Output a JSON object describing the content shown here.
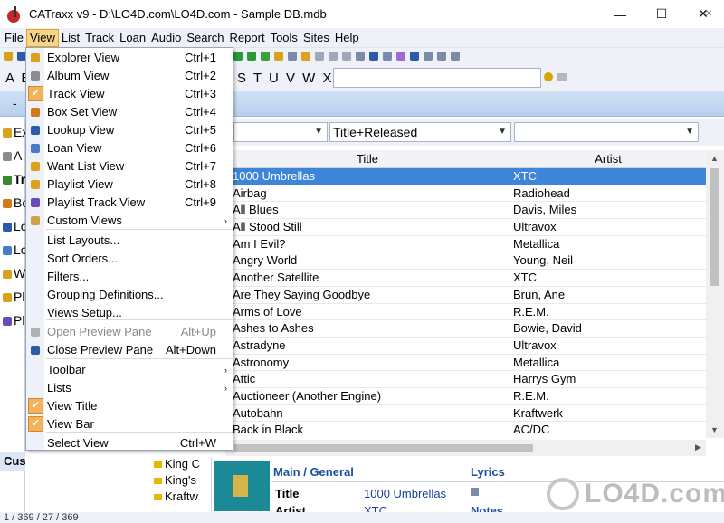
{
  "window": {
    "title": "CATraxx v9 - D:\\LO4D.com\\LO4D.com - Sample DB.mdb",
    "controls": [
      "—",
      "☐",
      "✕"
    ]
  },
  "menubar": [
    "File",
    "View",
    "List",
    "Track",
    "Loan",
    "Audio",
    "Search",
    "Report",
    "Tools",
    "Sites",
    "Help"
  ],
  "alphabar": {
    "left": "A B",
    "right": "S T U V W X Y Z"
  },
  "bluestrip": {
    "dash": "-"
  },
  "leftpanel": {
    "items": [
      "Ex",
      "A",
      "Tr",
      "Bo",
      "Lo",
      "Lo",
      "W",
      "Pl",
      "Pl"
    ],
    "custom": "Cus"
  },
  "filter": {
    "combo1": "",
    "combo2": "Title+Released",
    "combo3": ""
  },
  "grid": {
    "columns": {
      "title": "Title",
      "artist": "Artist"
    },
    "rows": [
      {
        "title": "1000 Umbrellas",
        "artist": "XTC"
      },
      {
        "title": "Airbag",
        "artist": "Radiohead"
      },
      {
        "title": "All Blues",
        "artist": "Davis, Miles"
      },
      {
        "title": "All Stood Still",
        "artist": "Ultravox"
      },
      {
        "title": "Am I Evil?",
        "artist": "Metallica"
      },
      {
        "title": "Angry World",
        "artist": "Young, Neil"
      },
      {
        "title": "Another Satellite",
        "artist": "XTC"
      },
      {
        "title": "Are They Saying Goodbye",
        "artist": "Brun, Ane"
      },
      {
        "title": "Arms of Love",
        "artist": "R.E.M."
      },
      {
        "title": "Ashes to Ashes",
        "artist": "Bowie, David"
      },
      {
        "title": "Astradyne",
        "artist": "Ultravox"
      },
      {
        "title": "Astronomy",
        "artist": "Metallica"
      },
      {
        "title": "Attic",
        "artist": "Harrys Gym"
      },
      {
        "title": "Auctioneer (Another Engine)",
        "artist": "R.E.M."
      },
      {
        "title": "Autobahn",
        "artist": "Kraftwerk"
      },
      {
        "title": "Back in Black",
        "artist": "AC/DC"
      }
    ]
  },
  "lowertree": [
    "King C",
    "King's",
    "Kraftw"
  ],
  "detail": {
    "main_header": "Main / General",
    "lyrics_header": "Lyrics",
    "title_label": "Title",
    "title_value": "1000 Umbrellas",
    "artist_label": "Artist",
    "artist_value": "XTC",
    "notes_header": "Notes"
  },
  "status": "1 / 369 / 27 / 369",
  "watermark": "LO4D.com",
  "view_menu": {
    "items": [
      {
        "label": "Explorer View",
        "shortcut": "Ctrl+1",
        "icon": "explorer-icon",
        "color": "#d9a21a"
      },
      {
        "label": "Album View",
        "shortcut": "Ctrl+2",
        "icon": "album-icon",
        "color": "#8c8c8c"
      },
      {
        "label": "Track View",
        "shortcut": "Ctrl+3",
        "icon": "track-icon",
        "color": "#3a8a2a",
        "checked": true
      },
      {
        "label": "Box Set View",
        "shortcut": "Ctrl+4",
        "icon": "boxset-icon",
        "color": "#d07a1a"
      },
      {
        "label": "Lookup View",
        "shortcut": "Ctrl+5",
        "icon": "lookup-icon",
        "color": "#2a5aa8"
      },
      {
        "label": "Loan View",
        "shortcut": "Ctrl+6",
        "icon": "loan-icon",
        "color": "#4a7ac8"
      },
      {
        "label": "Want List View",
        "shortcut": "Ctrl+7",
        "icon": "wantlist-icon",
        "color": "#d9a21a"
      },
      {
        "label": "Playlist View",
        "shortcut": "Ctrl+8",
        "icon": "playlist-icon",
        "color": "#d9a21a"
      },
      {
        "label": "Playlist Track View",
        "shortcut": "Ctrl+9",
        "icon": "playlist-track-icon",
        "color": "#6a4ab8"
      },
      {
        "label": "Custom Views",
        "shortcut": "",
        "submenu": true,
        "icon": "custom-views-icon",
        "color": "#c9a24a"
      },
      {
        "label": "List Layouts...",
        "shortcut": ""
      },
      {
        "label": "Sort Orders...",
        "shortcut": ""
      },
      {
        "label": "Filters...",
        "shortcut": ""
      },
      {
        "label": "Grouping Definitions...",
        "shortcut": ""
      },
      {
        "label": "Views Setup...",
        "shortcut": ""
      },
      {
        "label": "Open Preview Pane",
        "shortcut": "Alt+Up",
        "disabled": true,
        "icon": "open-preview-icon",
        "color": "#b0b0b0"
      },
      {
        "label": "Close Preview Pane",
        "shortcut": "Alt+Down",
        "icon": "close-preview-icon",
        "color": "#2a5aa8"
      },
      {
        "label": "Toolbar",
        "shortcut": "",
        "submenu": true
      },
      {
        "label": "Lists",
        "shortcut": "",
        "submenu": true
      },
      {
        "label": "View Title",
        "shortcut": "",
        "checked": true
      },
      {
        "label": "View Bar",
        "shortcut": "",
        "checked": true
      },
      {
        "label": "Select View",
        "shortcut": "Ctrl+W"
      }
    ]
  }
}
